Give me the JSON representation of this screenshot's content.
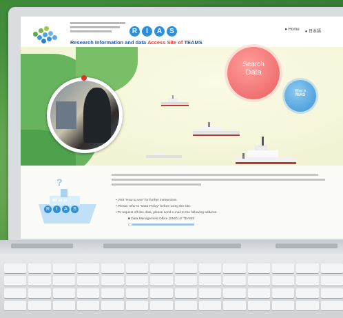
{
  "site": {
    "badge_letters": [
      "R",
      "I",
      "A",
      "S"
    ],
    "title_prefix": "Research Information and data ",
    "title_highlight": "Access Site of",
    "title_suffix": " TEAMS"
  },
  "header_links": [
    "Home",
    "日本語"
  ],
  "circles": {
    "search_line1": "Search",
    "search_line2": "Data",
    "whatis_line1": "What is",
    "whatis_line2": "RIAS"
  },
  "card": {
    "question_mark": "?",
    "what_is": "What is",
    "rias_letters": [
      "R",
      "I",
      "A",
      "S"
    ]
  },
  "bullets": [
    {
      "text": "Visit \"How to use\" for further instructions.",
      "link": "How to use"
    },
    {
      "text": "Please refer to \"Data Policy\" before using the site.",
      "link": "Data Policy"
    },
    {
      "text": "To request off-line data, please send e-mail to the following address."
    }
  ],
  "contact": "Data Management Office (DMO) of TEAMS",
  "colors": {
    "accent_blue": "#2f8fd6",
    "accent_red": "#e23d2f",
    "search_pink": "#ea5f62",
    "land_green": "#5fae5a"
  }
}
